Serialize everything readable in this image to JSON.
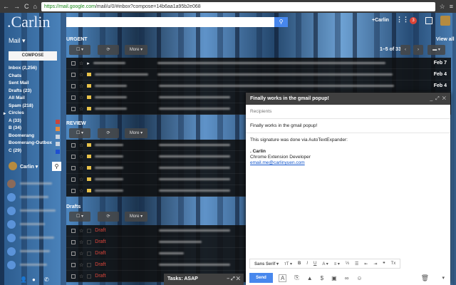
{
  "browser": {
    "url_host": "https://mail.google.com",
    "url_path": "/mail/u/0/#inbox?compose=14b6aa1a95b2e068"
  },
  "header": {
    "logo": ".Carlin",
    "user_link": "+Carlin",
    "notif_count": "3"
  },
  "sidebar": {
    "mail_label": "Mail ▾",
    "compose": "COMPOSE",
    "items": [
      {
        "label": "Inbox (2,256)"
      },
      {
        "label": "Chats"
      },
      {
        "label": "Sent Mail"
      },
      {
        "label": "Drafts (23)"
      },
      {
        "label": "All Mail"
      },
      {
        "label": "Spam (218)"
      },
      {
        "label": "Circles"
      },
      {
        "label": "A (33)",
        "color": "#c9453b"
      },
      {
        "label": "B (34)",
        "color": "#e38a3f"
      },
      {
        "label": "Boomerang",
        "color": "#c9d3e0"
      },
      {
        "label": "Boomerang-Outbox",
        "color": "#c9d3e0"
      },
      {
        "label": "C (29)",
        "color": "#1f4fd1"
      }
    ],
    "chat_user": "Carlin ▾"
  },
  "sections": [
    {
      "title": "URGENT",
      "view_all": "View all",
      "pagination": "1–5 of 33",
      "more": "More ▾",
      "dates": [
        "Feb 7",
        "Feb 4",
        "Feb 4",
        "",
        ""
      ]
    },
    {
      "title": "REVIEW",
      "more": "More ▾"
    },
    {
      "title": "Drafts",
      "more": "More ▾",
      "draft_label": "Draft"
    }
  ],
  "compose": {
    "title": "Finally works in the gmail popup!",
    "recipients_placeholder": "Recipients",
    "subject": "Finally works in the gmail popup!",
    "body_line1": "This signature was done via AutoTextExpander:",
    "sig_name": ". Carlin",
    "sig_title": "Chrome Extension Developer",
    "sig_email": "email.me@carlinyuen.com",
    "font": "Sans Serif ▾",
    "send": "Send"
  },
  "tasks": {
    "title": "Tasks: ASAP"
  }
}
